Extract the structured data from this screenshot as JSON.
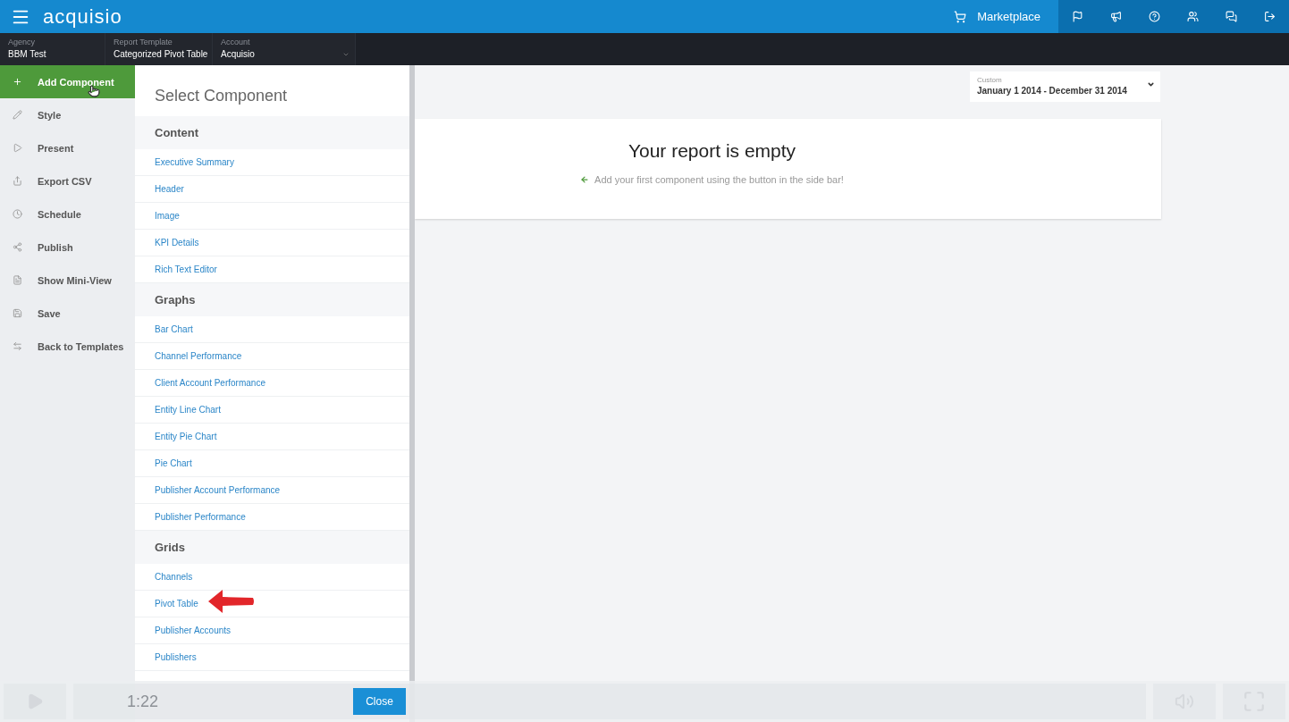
{
  "header": {
    "logo": "acquisio",
    "marketplace": "Marketplace"
  },
  "context_bar": [
    {
      "label": "Agency",
      "value": "BBM Test",
      "kind": "plain"
    },
    {
      "label": "Report Template",
      "value": "Categorized Pivot Table",
      "kind": "plain"
    },
    {
      "label": "Account",
      "value": "Acquisio",
      "kind": "dropdown"
    }
  ],
  "sidebar": {
    "items": [
      {
        "label": "Add Component",
        "selected": true
      },
      {
        "label": "Style",
        "selected": false
      },
      {
        "label": "Present",
        "selected": false
      },
      {
        "label": "Export CSV",
        "selected": false
      },
      {
        "label": "Schedule",
        "selected": false
      },
      {
        "label": "Publish",
        "selected": false
      },
      {
        "label": "Show Mini-View",
        "selected": false
      },
      {
        "label": "Save",
        "selected": false
      },
      {
        "label": "Back to Templates",
        "selected": false
      }
    ]
  },
  "panel": {
    "title": "Select Component",
    "sections": [
      {
        "title": "Content",
        "items": [
          "Executive Summary",
          "Header",
          "Image",
          "KPI Details",
          "Rich Text Editor"
        ]
      },
      {
        "title": "Graphs",
        "items": [
          "Bar Chart",
          "Channel Performance",
          "Client Account Performance",
          "Entity Line Chart",
          "Entity Pie Chart",
          "Pie Chart",
          "Publisher Account Performance",
          "Publisher Performance"
        ]
      },
      {
        "title": "Grids",
        "items": [
          "Channels",
          "Pivot Table",
          "Publisher Accounts",
          "Publishers"
        ]
      }
    ],
    "close_button": "Close"
  },
  "date_range": {
    "label": "Custom",
    "value": "January 1 2014 - December 31 2014"
  },
  "report": {
    "title": "Your report is empty",
    "hint": "Add your first component using the button in the side bar!"
  },
  "player": {
    "time": "1:22"
  }
}
